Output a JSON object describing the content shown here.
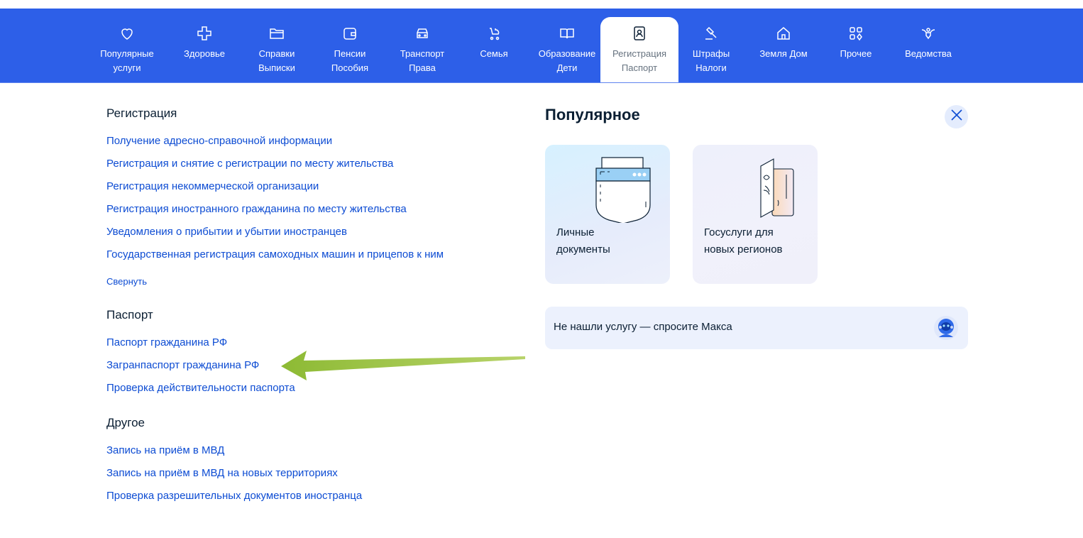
{
  "nav": {
    "items": [
      {
        "label": "Популярные\nуслуги",
        "icon": "heart-icon"
      },
      {
        "label": "Здоровье",
        "icon": "medical-cross-icon"
      },
      {
        "label": "Справки\nВыписки",
        "icon": "folder-icon"
      },
      {
        "label": "Пенсии\nПособия",
        "icon": "wallet-icon"
      },
      {
        "label": "Транспорт\nПрава",
        "icon": "car-icon"
      },
      {
        "label": "Семья",
        "icon": "stroller-icon"
      },
      {
        "label": "Образование\nДети",
        "icon": "book-icon"
      },
      {
        "label": "Регистрация\nПаспорт",
        "icon": "passport-icon"
      },
      {
        "label": "Штрафы\nНалоги",
        "icon": "gavel-icon"
      },
      {
        "label": "Земля Дом",
        "icon": "house-icon"
      },
      {
        "label": "Прочее",
        "icon": "grid-icon"
      },
      {
        "label": "Ведомства",
        "icon": "eagle-emblem-icon"
      }
    ],
    "active_index": 7,
    "color": "#2d5fe8"
  },
  "registration": {
    "title": "Регистрация",
    "links": [
      "Получение адресно-справочной информации",
      "Регистрация и снятие с регистрации по месту жительства",
      "Регистрация некоммерческой организации",
      "Регистрация иностранного гражданина по месту жительства",
      "Уведомления о прибытии и убытии иностранцев",
      "Государственная регистрация самоходных машин и прицепов к ним"
    ],
    "collapse_label": "Свернуть"
  },
  "passport": {
    "title": "Паспорт",
    "links": [
      "Паспорт гражданина РФ",
      "Загранпаспорт гражданина РФ",
      "Проверка действительности паспорта"
    ]
  },
  "other": {
    "title": "Другое",
    "links": [
      "Запись на приём в МВД",
      "Запись на приём в МВД на новых территориях",
      "Проверка разрешительных документов иностранца"
    ]
  },
  "popular": {
    "title": "Популярное",
    "cards": [
      {
        "label": "Личные\nдокументы",
        "icon": "document-pocket-icon"
      },
      {
        "label": "Госуслуги для\nновых регионов",
        "icon": "passport-book-icon"
      }
    ]
  },
  "ask": {
    "text": "Не нашли услугу — спросите Макса",
    "icon": "robot-avatar-icon"
  },
  "colors": {
    "link": "#0d4cd3",
    "text": "#0b1f33",
    "annotation_arrow": "#9cc23e"
  }
}
